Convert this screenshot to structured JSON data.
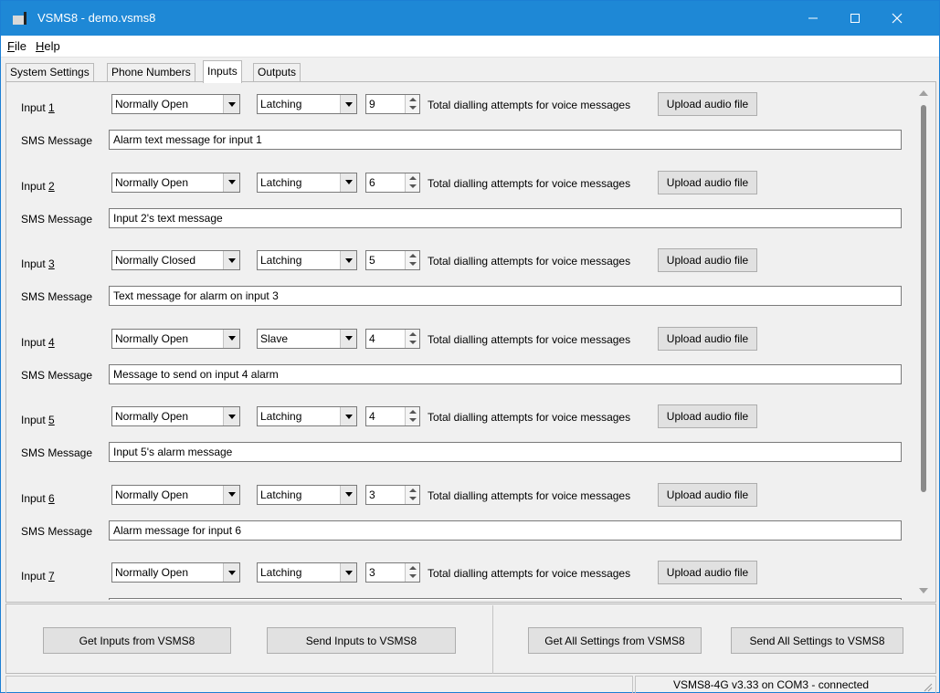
{
  "window": {
    "title": "VSMS8 - demo.vsms8"
  },
  "titlebar_icons": {
    "app": "app-icon",
    "minimize": "minimize-icon",
    "maximize": "maximize-icon",
    "close": "close-icon"
  },
  "menu": {
    "file": {
      "label": "File"
    },
    "help": {
      "label": "Help"
    }
  },
  "tabs": [
    {
      "label": "System Settings"
    },
    {
      "label": "Phone Numbers"
    },
    {
      "label": "Inputs"
    },
    {
      "label": "Outputs"
    }
  ],
  "common": {
    "attempts_label": "Total dialling attempts for voice messages",
    "upload_label": "Upload audio file",
    "sms_label": "SMS Message"
  },
  "inputs": [
    {
      "label": "Input 1",
      "contact": "Normally Open",
      "mode": "Latching",
      "attempts": "9",
      "message": "Alarm text message for input 1"
    },
    {
      "label": "Input 2",
      "contact": "Normally Open",
      "mode": "Latching",
      "attempts": "6",
      "message": "Input 2's text message"
    },
    {
      "label": "Input 3",
      "contact": "Normally Closed",
      "mode": "Latching",
      "attempts": "5",
      "message": "Text message for alarm on input 3"
    },
    {
      "label": "Input 4",
      "contact": "Normally Open",
      "mode": "Slave",
      "attempts": "4",
      "message": "Message to send on input 4 alarm"
    },
    {
      "label": "Input 5",
      "contact": "Normally Open",
      "mode": "Latching",
      "attempts": "4",
      "message": "Input 5's alarm message"
    },
    {
      "label": "Input 6",
      "contact": "Normally Open",
      "mode": "Latching",
      "attempts": "3",
      "message": "Alarm message for input 6"
    },
    {
      "label": "Input 7",
      "contact": "Normally Open",
      "mode": "Latching",
      "attempts": "3",
      "message": ""
    }
  ],
  "actions": {
    "get_inputs": "Get Inputs from VSMS8",
    "send_inputs": "Send Inputs to VSMS8",
    "get_all": "Get All Settings from VSMS8",
    "send_all": "Send All Settings to VSMS8"
  },
  "status": {
    "text": "VSMS8-4G v3.33 on COM3 - connected"
  },
  "colors": {
    "titlebar": "#1e88d6",
    "window_bg": "#f0f0f0"
  }
}
